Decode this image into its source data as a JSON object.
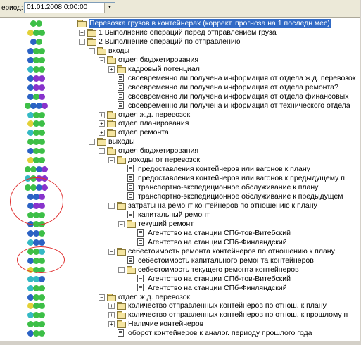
{
  "toolbar": {
    "period_label": "ериод:",
    "date_value": "01.01.2008 0:00:00"
  },
  "colors": {
    "green": "#3dbf47",
    "blue": "#2b62c4",
    "purple": "#8833cc",
    "yellow": "#e2d137",
    "cyan": "#34b9c4",
    "selection": "#316ac5"
  },
  "tree": [
    {
      "level": 0,
      "expander": "",
      "icon": "folder",
      "label": "Перевозка грузов в контейнерах (коррект. прогноза на 1 последн мес)",
      "selected": true
    },
    {
      "level": 1,
      "expander": "+",
      "icon": "folder",
      "label": "1 Выполнение операций перед отправлением груза"
    },
    {
      "level": 1,
      "expander": "-",
      "icon": "folder",
      "label": "2 Выполнение операций по отправлению"
    },
    {
      "level": 2,
      "expander": "-",
      "icon": "folder",
      "label": "входы"
    },
    {
      "level": 3,
      "expander": "-",
      "icon": "folder",
      "label": "отдел бюджетирования"
    },
    {
      "level": 4,
      "expander": "+",
      "icon": "folder",
      "label": "кадровый потенциал"
    },
    {
      "level": 4,
      "expander": "",
      "icon": "doc",
      "label": "своевременно ли получена информация от отдела ж.д. перевозок"
    },
    {
      "level": 4,
      "expander": "",
      "icon": "doc",
      "label": "своевременно ли получена информация от отдела ремонта?"
    },
    {
      "level": 4,
      "expander": "",
      "icon": "doc",
      "label": "своевременно ли получена информация от отдела финансовых"
    },
    {
      "level": 4,
      "expander": "",
      "icon": "doc",
      "label": "своевременно ли получена информация от технического отдела"
    },
    {
      "level": 3,
      "expander": "+",
      "icon": "folder",
      "label": "отдел ж.д. перевозок"
    },
    {
      "level": 3,
      "expander": "+",
      "icon": "folder",
      "label": "отдел планирования"
    },
    {
      "level": 3,
      "expander": "+",
      "icon": "folder",
      "label": "отдел ремонта"
    },
    {
      "level": 2,
      "expander": "-",
      "icon": "folder",
      "label": "выходы"
    },
    {
      "level": 3,
      "expander": "-",
      "icon": "folder",
      "label": "отдел бюджетирования"
    },
    {
      "level": 4,
      "expander": "-",
      "icon": "folder",
      "label": "доходы от перевозок"
    },
    {
      "level": 5,
      "expander": "",
      "icon": "doc",
      "label": "предоставления контейнеров или вагонов к плану"
    },
    {
      "level": 5,
      "expander": "",
      "icon": "doc",
      "label": "предоставления контейнеров или вагонов к предыдущему п"
    },
    {
      "level": 5,
      "expander": "",
      "icon": "doc",
      "label": "транспортно-экспедиционное обслуживание к плану"
    },
    {
      "level": 5,
      "expander": "",
      "icon": "doc",
      "label": "транспортно-экспедиционное обслуживание к предыдущем"
    },
    {
      "level": 4,
      "expander": "-",
      "icon": "folder",
      "label": "затраты на ремонт контейнеров по отношению к плану"
    },
    {
      "level": 5,
      "expander": "",
      "icon": "doc",
      "label": "капитальный ремонт"
    },
    {
      "level": 5,
      "expander": "-",
      "icon": "folder",
      "label": "текущий ремонт"
    },
    {
      "level": 6,
      "expander": "",
      "icon": "doc",
      "label": "Агентство на станции СПб-тов-Витебский"
    },
    {
      "level": 6,
      "expander": "",
      "icon": "doc",
      "label": "Агентство на станции СПб-Финляндский"
    },
    {
      "level": 4,
      "expander": "-",
      "icon": "folder",
      "label": "себестоимость ремонта контейнеров по отношению к плану"
    },
    {
      "level": 5,
      "expander": "",
      "icon": "doc",
      "label": "себестоимость капитального ремонта контейнеров"
    },
    {
      "level": 5,
      "expander": "-",
      "icon": "folder",
      "label": "себестоимость текущего ремонта контейнеров"
    },
    {
      "level": 6,
      "expander": "",
      "icon": "doc",
      "label": "Агентство на станции СПб-тов-Витебский"
    },
    {
      "level": 6,
      "expander": "",
      "icon": "doc",
      "label": "Агентство на станции СПб-Финляндский"
    },
    {
      "level": 3,
      "expander": "-",
      "icon": "folder",
      "label": "отдел ж.д. перевозок"
    },
    {
      "level": 4,
      "expander": "+",
      "icon": "folder",
      "label": "количество отправленных контейнеров по отнош. к плану"
    },
    {
      "level": 4,
      "expander": "+",
      "icon": "folder",
      "label": "количество отправленных контейнеров по отнош. к прошлому п"
    },
    {
      "level": 4,
      "expander": "+",
      "icon": "folder",
      "label": "Наличие контейнеров"
    },
    {
      "level": 4,
      "expander": "",
      "icon": "doc",
      "label": "оборот контейнеров к аналог. периоду прошлого года"
    }
  ],
  "indicators": [
    [
      "green",
      "green"
    ],
    [
      "yellow",
      "green",
      "green"
    ],
    [
      "blue",
      "green"
    ],
    [
      "blue",
      "green",
      "green"
    ],
    [
      "blue",
      "green",
      "green"
    ],
    [
      "cyan",
      "green",
      "green"
    ],
    [
      "blue",
      "purple",
      "purple"
    ],
    [
      "blue",
      "purple",
      "purple"
    ],
    [
      "blue",
      "green",
      "purple"
    ],
    [
      "green",
      "blue",
      "blue",
      "purple"
    ],
    [
      "cyan",
      "green",
      "green"
    ],
    [
      "yellow",
      "green",
      "green"
    ],
    [
      "cyan",
      "green",
      "green"
    ],
    [
      "green",
      "green",
      "green"
    ],
    [
      "blue",
      "green",
      "green"
    ],
    [
      "yellow",
      "green",
      "green"
    ],
    [
      "green",
      "green",
      "blue",
      "purple"
    ],
    [
      "cyan",
      "green",
      "purple",
      "purple"
    ],
    [
      "green",
      "green",
      "blue",
      "purple"
    ],
    [
      "blue",
      "blue",
      "purple"
    ],
    [
      "blue",
      "purple",
      "purple"
    ],
    [
      "green",
      "green",
      "green"
    ],
    [
      "blue",
      "green",
      "green"
    ],
    [
      "blue",
      "blue",
      "green"
    ],
    [
      "cyan",
      "blue",
      "blue"
    ],
    [
      "green",
      "green",
      "cyan"
    ],
    [
      "blue",
      "green",
      "green"
    ],
    [
      "yellow",
      "green",
      "green"
    ],
    [
      "cyan",
      "cyan",
      "blue"
    ],
    [
      "cyan",
      "green",
      "green"
    ],
    [
      "blue",
      "green",
      "green"
    ],
    [
      "yellow",
      "green",
      "green"
    ],
    [
      "cyan",
      "green",
      "green"
    ],
    [
      "green",
      "green",
      "green"
    ],
    [
      "blue",
      "green",
      "green"
    ]
  ]
}
